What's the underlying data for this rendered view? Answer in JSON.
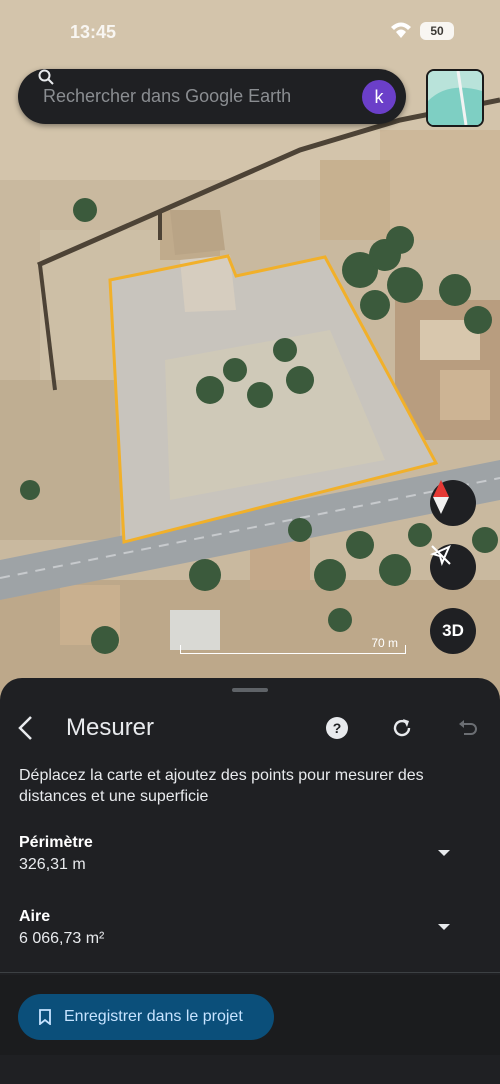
{
  "status_bar": {
    "time": "13:45",
    "battery": "50"
  },
  "search": {
    "placeholder": "Rechercher dans Google Earth",
    "avatar_letter": "k"
  },
  "map": {
    "scale_label": "70 m",
    "three_d_label": "3D",
    "outline_color": "#f1b02a"
  },
  "measure_panel": {
    "title": "Mesurer",
    "description": "Déplacez la carte et ajoutez des points pour mesurer des distances et une superficie",
    "perimeter": {
      "label": "Périmètre",
      "value": "326,31 m"
    },
    "area": {
      "label": "Aire",
      "value": "6 066,73 m²"
    },
    "save_label": "Enregistrer dans le projet"
  },
  "colors": {
    "accent_button": "#0b4f7a",
    "panel": "#1f2023",
    "avatar": "#6b3fc9"
  },
  "icons": [
    "search-icon",
    "wifi-icon",
    "layers-thumbnail",
    "compass-icon",
    "location-off-icon",
    "back-icon",
    "help-icon",
    "reset-icon",
    "undo-icon",
    "bookmark-icon",
    "dropdown-caret-icon"
  ]
}
